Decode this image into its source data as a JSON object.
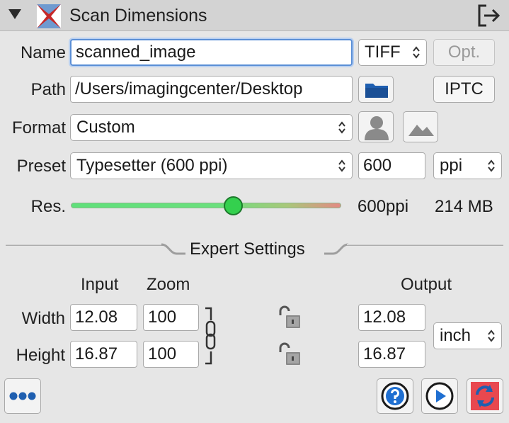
{
  "header": {
    "title": "Scan Dimensions",
    "icons": {
      "disclosure": "disclosure-triangle-icon",
      "logo": "app-logo-icon",
      "exit": "exit-panel-icon"
    }
  },
  "name_row": {
    "label": "Name",
    "value": "scanned_image",
    "file_type": "TIFF",
    "options_label": "Opt."
  },
  "path_row": {
    "label": "Path",
    "value": "/Users/imagingcenter/Desktop",
    "iptc_label": "IPTC"
  },
  "format_row": {
    "label": "Format",
    "value": "Custom"
  },
  "preset_row": {
    "label": "Preset",
    "value": "Typesetter (600 ppi)",
    "resolution_value": "600",
    "resolution_unit": "ppi"
  },
  "res_row": {
    "label": "Res.",
    "slider_fraction": 0.6,
    "readout": "600ppi",
    "file_size": "214 MB"
  },
  "expert": {
    "title": "Expert Settings",
    "input_header": "Input",
    "zoom_header": "Zoom",
    "output_header": "Output",
    "width_label": "Width",
    "height_label": "Height",
    "width_input": "12.08",
    "height_input": "16.87",
    "width_zoom": "100",
    "height_zoom": "100",
    "width_output": "12.08",
    "height_output": "16.87",
    "output_unit": "inch"
  },
  "colors": {
    "accent": "#1f6fd1",
    "slider_thumb": "#34d04e",
    "refresh": "#e8484f"
  }
}
